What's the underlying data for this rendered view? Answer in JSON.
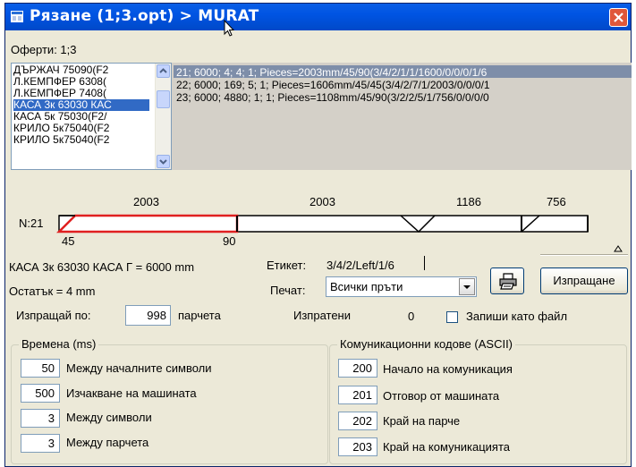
{
  "window": {
    "title": "Рязане (1;3.opt) > MURAT"
  },
  "offers_label": "Оферти:  1;3",
  "profiles_list": [
    {
      "label": "ДЪРЖАЧ 75090(F2",
      "selected": false
    },
    {
      "label": "Л.КЕМПФЕР 6308(",
      "selected": false
    },
    {
      "label": "Л.КЕМПФЕР 7408(",
      "selected": false
    },
    {
      "label": "КАСА 3к 63030 КАС",
      "selected": true
    },
    {
      "label": "КАСА 5к 75030(F2/",
      "selected": false
    },
    {
      "label": "КРИЛО 5к75040(F2",
      "selected": false
    },
    {
      "label": "КРИЛО 5к75040(F2",
      "selected": false
    }
  ],
  "orders_list": [
    "21; 6000;  4;  4;  1;  Pieces=2003mm/45/90(3/4/2/1/1/1600/0/0/0/1/6",
    "22; 6000;  169;  5;  1;  Pieces=1606mm/45/45(3/4/2/7/1/2003/0/0/0/1",
    "23; 6000;  4880;  1;  1;  Pieces=1108mm/45/90(3/2/2/5/1/756/0/0/0/0"
  ],
  "bar": {
    "row_label": "N:21",
    "piece_lengths": [
      "2003",
      "2003",
      "1186",
      "756"
    ],
    "angle_left": "45",
    "angle_right": "90"
  },
  "profile_info": "КАСА 3к 63030 КАСА Г = 6000 mm",
  "remainder": "Остатък = 4 mm",
  "label_field": {
    "caption": "Етикет:",
    "value": "3/4/2/Left/1/6"
  },
  "print_field": {
    "caption": "Печат:",
    "value": "Всички пръти"
  },
  "send_button": "Изпращане",
  "send_per": {
    "caption": "Изпращай по:",
    "value": "998",
    "unit": "парчета"
  },
  "sent": {
    "caption": "Изпратени",
    "value": "0"
  },
  "save_as_file": {
    "label": "Запиши като файл",
    "checked": false
  },
  "timings": {
    "title": "Времена (ms)",
    "rows": [
      {
        "value": "50",
        "label": "Между началните символи"
      },
      {
        "value": "500",
        "label": "Изчакване на машината"
      },
      {
        "value": "3",
        "label": "Между символи"
      },
      {
        "value": "3",
        "label": "Между парчета"
      }
    ]
  },
  "codes": {
    "title": "Комуникационни кодове (ASCII)",
    "rows": [
      {
        "value": "200",
        "label": "Начало на комуникация"
      },
      {
        "value": "201",
        "label": "Отговор от машината"
      },
      {
        "value": "202",
        "label": "Край на парче"
      },
      {
        "value": "203",
        "label": "Край на комуникацията"
      }
    ]
  },
  "colors": {
    "titlebar": "#0054e3",
    "selection": "#316ac5",
    "first_piece": "#e02020"
  }
}
